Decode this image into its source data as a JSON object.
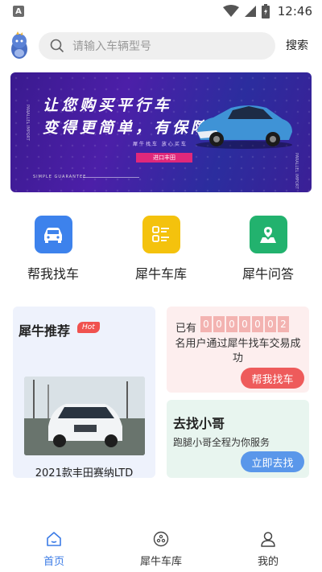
{
  "status_bar": {
    "sim_label": "A",
    "time": "12:46"
  },
  "header": {
    "search_placeholder": "请输入车辆型号",
    "search_button": "搜索"
  },
  "banner": {
    "line1": "让您购买平行车",
    "line2": "变得更简单，有保障",
    "slogan": "犀牛找车 放心买车",
    "button_label": "进口丰田",
    "footer_text": "SIMPLE GUARANTEE",
    "side_text": "PARALLEL IMPORT"
  },
  "quick_entries": [
    {
      "label": "帮我找车",
      "icon": "car-icon",
      "color": "#3d82ec"
    },
    {
      "label": "犀牛车库",
      "icon": "checklist-icon",
      "color": "#f4c20d"
    },
    {
      "label": "犀牛问答",
      "icon": "map-location-icon",
      "color": "#22b26e"
    }
  ],
  "recommend": {
    "title": "犀牛推荐",
    "badge": "Hot",
    "caption": "2021款丰田赛纳LTD"
  },
  "find_car": {
    "prefix": "已有",
    "digits": [
      "0",
      "0",
      "0",
      "0",
      "0",
      "0",
      "2"
    ],
    "description": "名用户通过犀牛找车交易成功",
    "button": "帮我找车"
  },
  "find_guy": {
    "title": "去找小哥",
    "description": "跑腿小哥全程为你服务",
    "button": "立即去找"
  },
  "bottom_nav": [
    {
      "label": "首页",
      "icon": "home-icon",
      "active": true
    },
    {
      "label": "犀牛车库",
      "icon": "garage-icon",
      "active": false
    },
    {
      "label": "我的",
      "icon": "user-icon",
      "active": false
    }
  ],
  "colors": {
    "accent": "#3b7be6",
    "hot_red": "#f0524f",
    "find_button": "#ee5b5b",
    "guy_button": "#5a97ea"
  }
}
